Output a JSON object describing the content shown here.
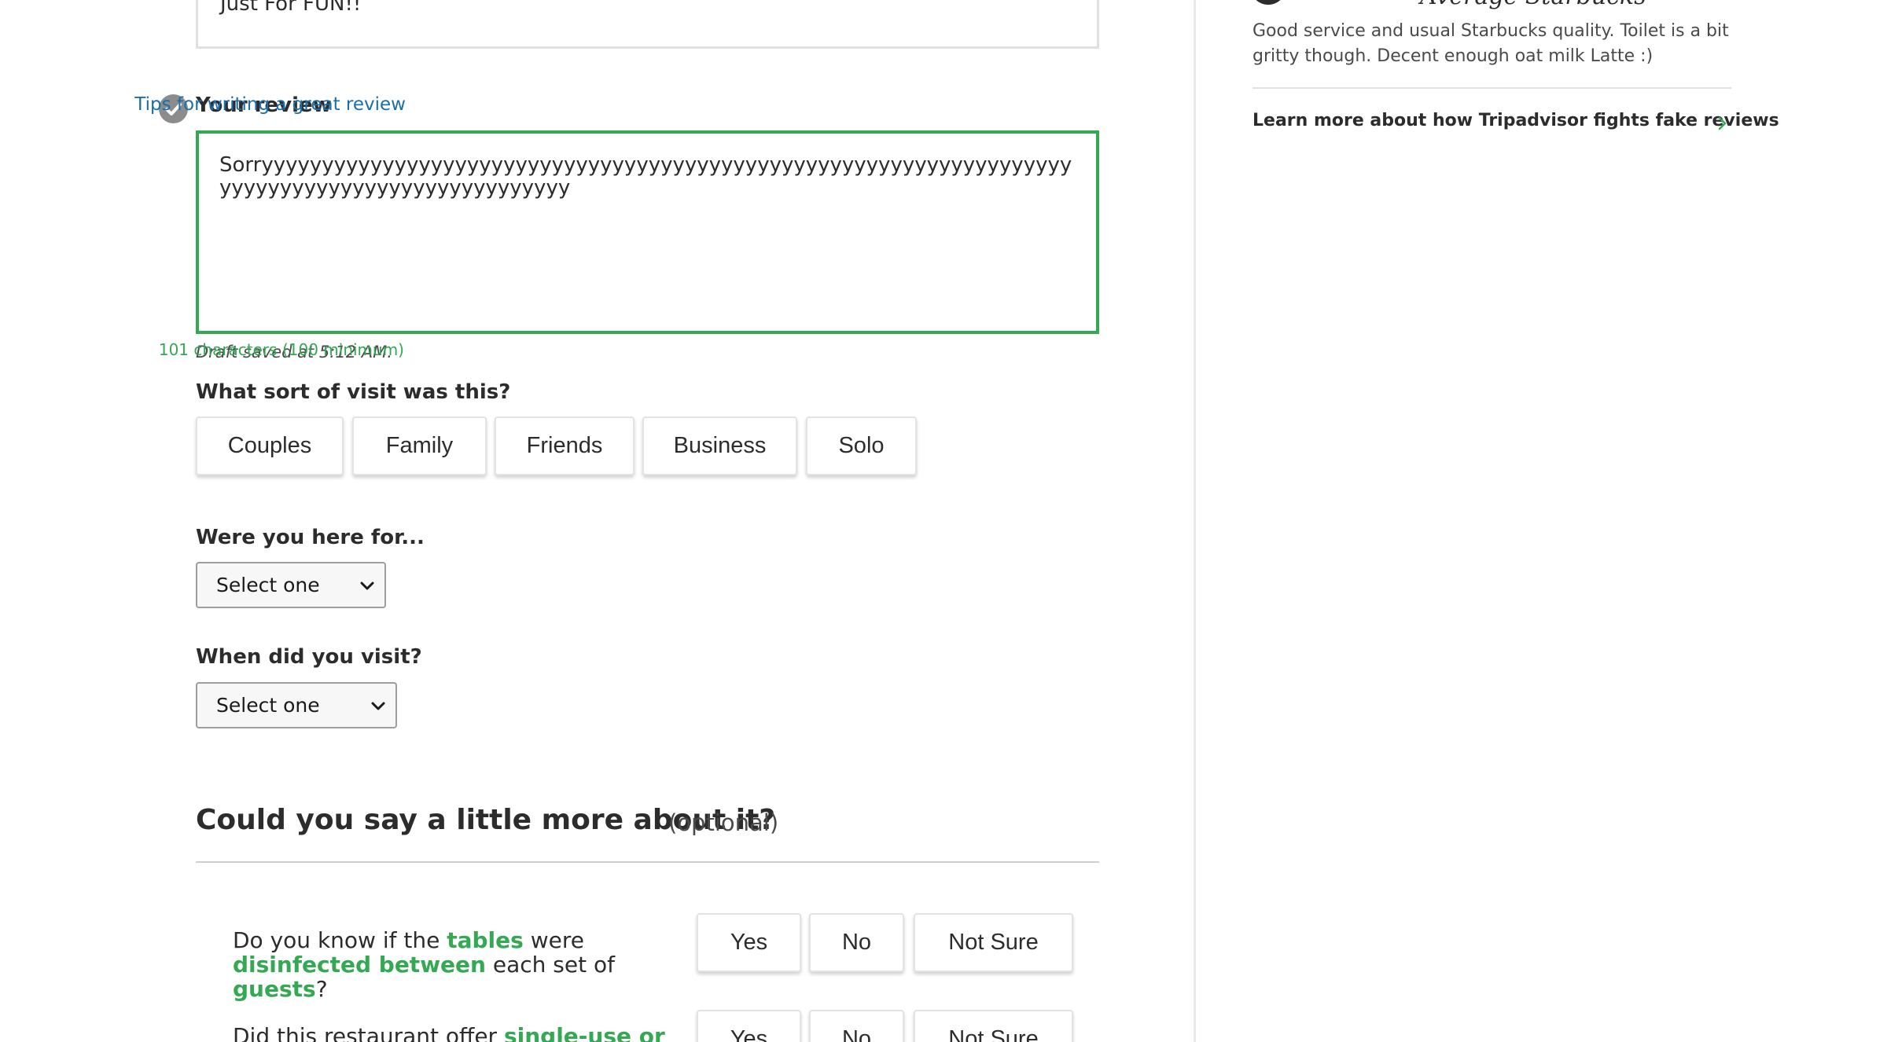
{
  "trip_title": {
    "value": "Just For FUN!!"
  },
  "review": {
    "label": "Your review",
    "tips_link": "Tips for writing a great review",
    "text": "Sorryyyyyyyyyyyyyyyyyyyyyyyyyyyyyyyyyyyyyyyyyyyyyyyyyyyyyyyyyyyyyyyyyyyyyyyyyyyyyyyyyyyyyyyyyyyyyyyy",
    "draft_status": "Draft saved at 5:12 AM.",
    "char_count": "101 characters (100 minimum)",
    "accent_color": "#34a853"
  },
  "visit_type": {
    "question": "What sort of visit was this?",
    "options": [
      "Couples",
      "Family",
      "Friends",
      "Business",
      "Solo"
    ]
  },
  "here_for": {
    "question": "Were you here for...",
    "selected": "Select one"
  },
  "when_visit": {
    "question": "When did you visit?",
    "selected": "Select one"
  },
  "more_about": {
    "title": "Could you say a little more about it?",
    "optional": "(optional)"
  },
  "safety_questions": [
    {
      "parts": [
        "Do you know if the ",
        "tables",
        " were ",
        "disinfected between",
        " each set of ",
        "guests",
        "?"
      ],
      "options": [
        "Yes",
        "No",
        "Not Sure"
      ]
    },
    {
      "parts": [
        "Did this restaurant offer ",
        "single-use or"
      ],
      "options": [
        "Yes",
        "No",
        "Not Sure"
      ]
    }
  ],
  "sidebar": {
    "snippet_title": "Average Starbucks",
    "snippet_text": "Good service and usual Starbucks quality. Toilet is a bit gritty though. Decent enough oat milk Latte :)",
    "learn_more": "Learn more about how Tripadvisor fights fake reviews",
    "icons": [
      "check-circle-icon",
      "chevron-down-icon",
      "chevron-right-icon"
    ]
  }
}
